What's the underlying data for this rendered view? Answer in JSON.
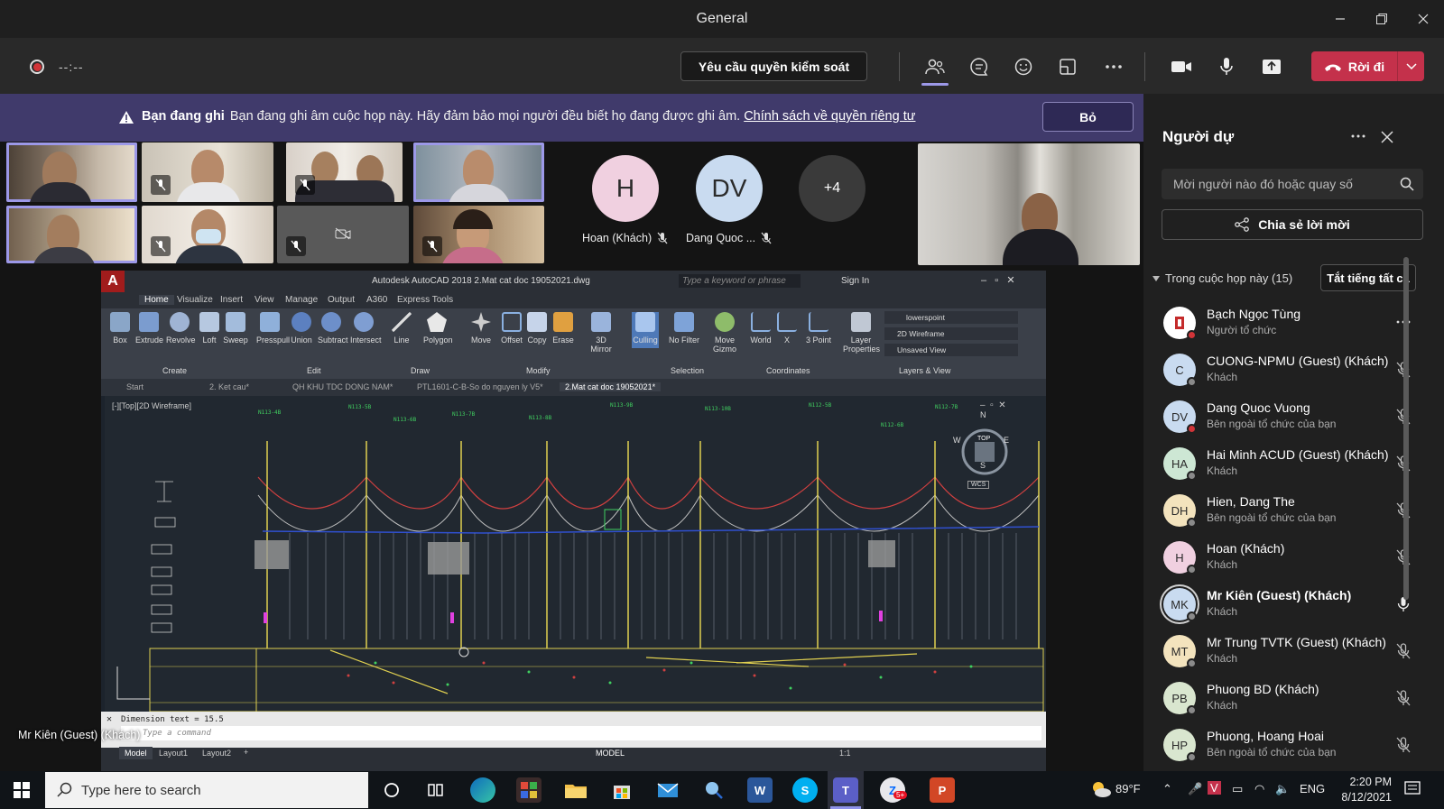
{
  "window": {
    "title": "General",
    "controls": [
      "minimize",
      "restore",
      "close"
    ]
  },
  "meeting_bar": {
    "timer": "--:--",
    "request_control_label": "Yêu cầu quyền kiểm soát",
    "leave_label": "Rời đi"
  },
  "banner": {
    "title": "Bạn đang ghi",
    "message": "Bạn đang ghi âm cuộc họp này. Hãy đảm bảo mọi người đều biết họ đang được ghi âm.",
    "link": "Chính sách về quyền riêng tư",
    "dismiss_label": "Bỏ"
  },
  "stage": {
    "avatar_tiles": [
      {
        "initials": "H",
        "name": "Hoan (Khách)",
        "color": "#f0d0e0"
      },
      {
        "initials": "DV",
        "name": "Dang Quoc ...",
        "color": "#c9dbf0"
      }
    ],
    "overflow_count": "+4",
    "shared_by": "Mr Kiên (Guest) (Khách)"
  },
  "autocad": {
    "logo": "A",
    "title": "Autodesk AutoCAD 2018   2.Mat cat doc 19052021.dwg",
    "search_placeholder": "Type a keyword or phrase",
    "sign_in": "Sign In",
    "menu_tabs": [
      "Home",
      "Visualize",
      "Insert",
      "View",
      "Manage",
      "Output",
      "A360",
      "Express Tools"
    ],
    "ribbon_buttons": [
      "Box",
      "Extrude",
      "Revolve",
      "Loft",
      "Sweep",
      "Presspull",
      "Union",
      "Subtract",
      "Intersect",
      "Line",
      "Polygon",
      "Move",
      "Offset",
      "Copy",
      "Erase",
      "3D Mirror",
      "Culling",
      "No Filter",
      "Move Gizmo",
      "World",
      "X",
      "3 Point",
      "Layer Properties"
    ],
    "ribbon_groups": [
      "Create",
      "Edit",
      "Draw",
      "Modify",
      "Selection",
      "Coordinates",
      "Layers & View"
    ],
    "layer_dropdowns": [
      "lowerspoint",
      "2D Wireframe",
      "Unsaved View"
    ],
    "doc_tabs": [
      "Start",
      "2. Ket cau*",
      "QH KHU TDC DONG NAM*",
      "PTL1601-C-B-So do nguyen ly V5*",
      "2.Mat cat doc 19052021*"
    ],
    "viewport_label": "[-][Top][2D Wireframe]",
    "viewcube": {
      "n": "N",
      "s": "S",
      "e": "E",
      "w": "W",
      "top": "TOP",
      "wcs": "WCS"
    },
    "command_history": "Dimension text = 15.5",
    "command_placeholder": "Type a command",
    "layout_tabs": [
      "Model",
      "Layout1",
      "Layout2"
    ],
    "status_mode": "MODEL",
    "scale": "1:1"
  },
  "panel": {
    "title": "Người dự",
    "search_placeholder": "Mời người nào đó hoặc quay số",
    "invite_label": "Chia sẻ lời mời",
    "in_meeting_label": "Trong cuộc họp này (15)",
    "mute_all_label": "Tắt tiếng tất cả",
    "participants": [
      {
        "initials": "",
        "name": "Bạch Ngọc Tùng",
        "role": "Người tổ chức",
        "color": "#ffffff",
        "mic": "more"
      },
      {
        "initials": "C",
        "name": "CUONG-NPMU (Guest) (Khách)",
        "role": "Khách",
        "color": "#c9dbf0",
        "mic": "muted"
      },
      {
        "initials": "DV",
        "name": "Dang Quoc Vuong",
        "role": "Bên ngoài tổ chức của bạn",
        "color": "#c9dbf0",
        "mic": "muted"
      },
      {
        "initials": "HA",
        "name": "Hai Minh ACUD (Guest) (Khách)",
        "role": "Khách",
        "color": "#cde7d4",
        "mic": "muted"
      },
      {
        "initials": "DH",
        "name": "Hien, Dang The",
        "role": "Bên ngoài tổ chức của bạn",
        "color": "#f3e3bd",
        "mic": "muted"
      },
      {
        "initials": "H",
        "name": "Hoan (Khách)",
        "role": "Khách",
        "color": "#f0d0e0",
        "mic": "muted"
      },
      {
        "initials": "MK",
        "name": "Mr Kiên (Guest) (Khách)",
        "role": "Khách",
        "color": "#c9dbf0",
        "mic": "on"
      },
      {
        "initials": "MT",
        "name": "Mr Trung TVTK (Guest) (Khách)",
        "role": "Khách",
        "color": "#f3e3bd",
        "mic": "muted"
      },
      {
        "initials": "PB",
        "name": "Phuong BD (Khách)",
        "role": "Khách",
        "color": "#d9e6cf",
        "mic": "muted"
      },
      {
        "initials": "HP",
        "name": "Phuong, Hoang Hoai",
        "role": "Bên ngoài tổ chức của bạn",
        "color": "#d9e6cf",
        "mic": "muted"
      }
    ]
  },
  "taskbar": {
    "search_placeholder": "Type here to search",
    "weather": "89°F",
    "language": "ENG",
    "time": "2:20 PM",
    "date": "8/12/2021",
    "notification_badge": "5+"
  },
  "colors": {
    "accent": "#6264a7",
    "leave": "#c4314b",
    "banner": "#403a6b",
    "active_tile": "#9c98e8"
  }
}
